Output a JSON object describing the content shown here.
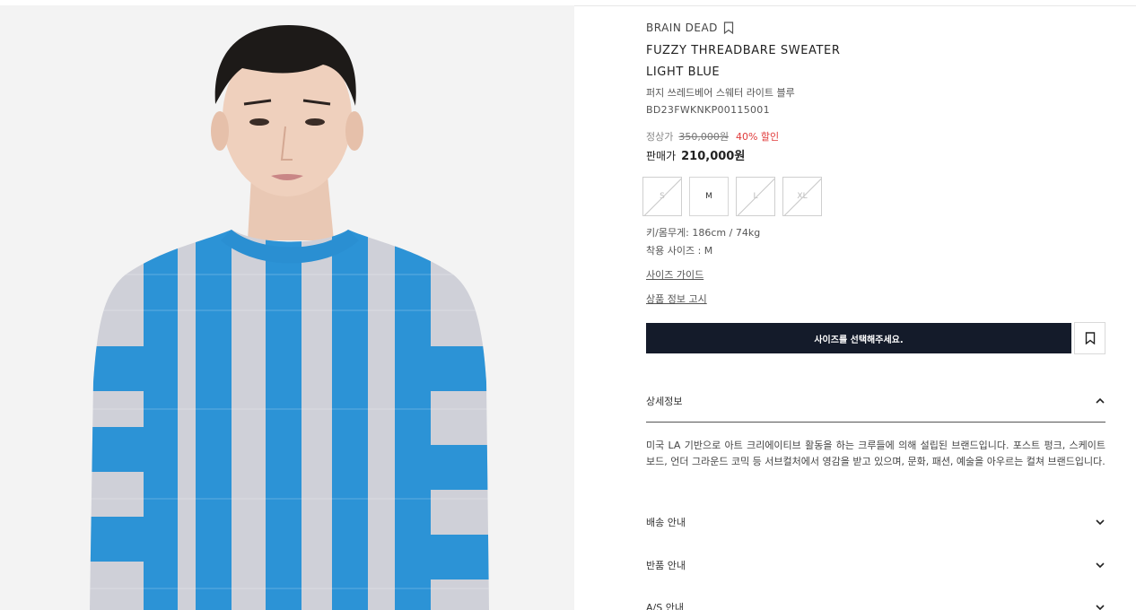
{
  "product": {
    "brand": "BRAIN DEAD",
    "name_line1": "FUZZY THREADBARE SWEATER",
    "name_line2": "LIGHT BLUE",
    "korean_name": "퍼지 쓰레드베어 스웨터 라이트 블루",
    "code": "BD23FWKNKP00115001",
    "image_icon": "product-photo"
  },
  "price": {
    "original_label": "정상가",
    "original_value": "350,000원",
    "discount": "40% 할인",
    "sale_label": "판매가",
    "sale_value": "210,000원",
    "discount_color": "#e03b3b"
  },
  "sizes": [
    {
      "label": "S",
      "available": false
    },
    {
      "label": "M",
      "available": true
    },
    {
      "label": "L",
      "available": false
    },
    {
      "label": "XL",
      "available": false
    }
  ],
  "fit": {
    "model_stats": "키/몸무게: 186cm / 74kg",
    "worn_size": "착용 사이즈 : M"
  },
  "links": {
    "size_guide": "사이즈 가이드",
    "product_notice": "상품 정보 고시"
  },
  "actions": {
    "cta_label": "사이즈를 선택해주세요.",
    "cta_color": "#141b2a",
    "wishlist_icon": "bookmark-icon"
  },
  "accordion": [
    {
      "title": "상세정보",
      "expanded": true,
      "body": "미국 LA 기반으로 아트 크리에이티브 활동을 하는 크루들에 의해 설립된 브랜드입니다. 포스트 펑크, 스케이트 보드, 언더 그라운드 코믹 등 서브컬처에서 영감을 받고 있으며, 문화, 패션, 예술을 아우르는 컬쳐 브랜드입니다."
    },
    {
      "title": "배송 안내",
      "expanded": false
    },
    {
      "title": "반품 안내",
      "expanded": false
    },
    {
      "title": "A/S 안내",
      "expanded": false
    }
  ]
}
